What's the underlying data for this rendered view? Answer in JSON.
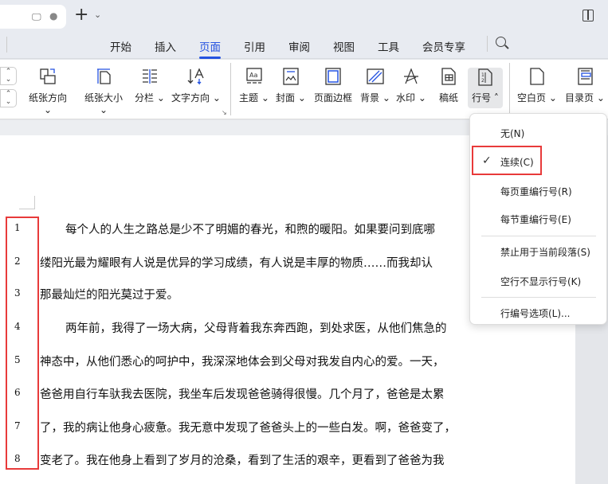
{
  "menubar": {
    "items": [
      "开始",
      "插入",
      "页面",
      "引用",
      "审阅",
      "视图",
      "工具",
      "会员专享"
    ],
    "active": "页面"
  },
  "ribbon": {
    "buttons": [
      {
        "label": "纸张方向",
        "dropdown": true
      },
      {
        "label": "纸张大小",
        "dropdown": true
      },
      {
        "label": "分栏",
        "dropdown": true
      },
      {
        "label": "文字方向",
        "dropdown": true
      },
      {
        "label": "主题",
        "dropdown": true
      },
      {
        "label": "封面",
        "dropdown": true
      },
      {
        "label": "页面边框",
        "dropdown": false
      },
      {
        "label": "背景",
        "dropdown": true
      },
      {
        "label": "水印",
        "dropdown": true
      },
      {
        "label": "稿纸",
        "dropdown": false
      },
      {
        "label": "行号",
        "dropdown": true
      },
      {
        "label": "空白页",
        "dropdown": true
      },
      {
        "label": "目录页",
        "dropdown": true
      }
    ]
  },
  "dropdown": {
    "items": [
      {
        "label": "无(N)"
      },
      {
        "label": "连续(C)",
        "checked": true
      },
      {
        "label": "每页重编行号(R)"
      },
      {
        "label": "每节重编行号(E)"
      },
      {
        "label": "禁止用于当前段落(S)"
      },
      {
        "label": "空行不显示行号(K)"
      },
      {
        "label": "行编号选项(L)..."
      }
    ]
  },
  "document": {
    "lines": [
      {
        "num": "1",
        "text": "每个人的人生之路总是少不了明媚的春光，和煦的暖阳。如果要问到底哪"
      },
      {
        "num": "2",
        "text": "缕阳光最为耀眼有人说是优异的学习成绩，有人说是丰厚的物质……而我却认"
      },
      {
        "num": "3",
        "text": "那最灿烂的阳光莫过于爱。"
      },
      {
        "num": "4",
        "text": "两年前，我得了一场大病，父母背着我东奔西跑，到处求医，从他们焦急的"
      },
      {
        "num": "5",
        "text": "神态中，从他们悉心的呵护中，我深深地体会到父母对我发自内心的爱。一天，"
      },
      {
        "num": "6",
        "text": "爸爸用自行车驮我去医院，我坐车后发现爸爸骑得很慢。几个月了，爸爸是太累"
      },
      {
        "num": "7",
        "text": "了，我的病让他身心疲惫。我无意中发现了爸爸头上的一些白发。啊，爸爸变了，"
      },
      {
        "num": "8",
        "text": "变老了。我在他身上看到了岁月的沧桑，看到了生活的艰辛，更看到了爸爸为我"
      }
    ]
  },
  "colors": {
    "accent": "#2452e0",
    "highlight": "#e83a3a"
  }
}
